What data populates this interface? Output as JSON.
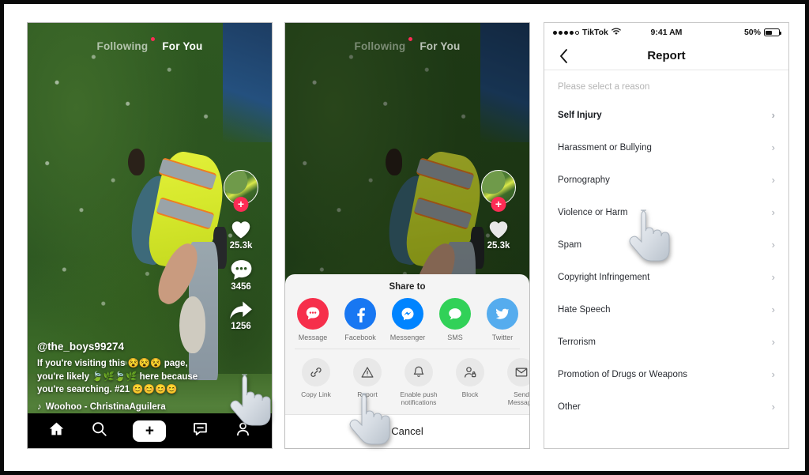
{
  "phone1": {
    "topnav": {
      "following": "Following",
      "for_you": "For You"
    },
    "rail": {
      "follow_badge": "+",
      "like_count": "25.3k",
      "comment_count": "3456",
      "share_count": "1256"
    },
    "caption": {
      "username": "@the_boys99274",
      "text": "If you're visiting this 😵😵😵 page, you're likely 🍃🌿🍃🌿 here because you're searching. #21 😊😊😊😊",
      "music": "Woohoo - ChristinaAguilera",
      "music_icon": "music-note-icon"
    },
    "bottomnav": [
      {
        "name": "home",
        "icon": "home-icon"
      },
      {
        "name": "discover",
        "icon": "search-icon"
      },
      {
        "name": "create",
        "icon": "plus-icon",
        "label": "+"
      },
      {
        "name": "inbox",
        "icon": "inbox-icon"
      },
      {
        "name": "profile",
        "icon": "person-icon"
      }
    ]
  },
  "phone2": {
    "topnav": {
      "following": "Following",
      "for_you": "For You"
    },
    "rail": {
      "follow_badge": "+",
      "like_count": "25.3k"
    },
    "sheet": {
      "title": "Share to",
      "share_targets": [
        {
          "label": "Message",
          "icon": "message-bubble-icon",
          "color": "#f62f4b"
        },
        {
          "label": "Facebook",
          "icon": "facebook-icon",
          "color": "#1877f2"
        },
        {
          "label": "Messenger",
          "icon": "messenger-icon",
          "color": "#0084ff"
        },
        {
          "label": "SMS",
          "icon": "sms-icon",
          "color": "#31d158"
        },
        {
          "label": "Twitter",
          "icon": "twitter-icon",
          "color": "#55acee"
        },
        {
          "label": "",
          "icon": "more-share-icon",
          "color": "#4a90e2"
        }
      ],
      "actions": [
        {
          "label": "Copy Link",
          "icon": "link-icon"
        },
        {
          "label": "Report",
          "icon": "warning-triangle-icon"
        },
        {
          "label": "Enable push notifications",
          "icon": "bell-icon"
        },
        {
          "label": "Block",
          "icon": "person-lock-icon"
        },
        {
          "label": "Send Message",
          "icon": "envelope-icon"
        }
      ],
      "cancel": "Cancel"
    }
  },
  "phone3": {
    "statusbar": {
      "carrier": "TikTok",
      "signal_icon": "signal-dots-icon",
      "wifi_icon": "wifi-icon",
      "time": "9:41 AM",
      "battery_percent": "50%",
      "battery_icon": "battery-icon"
    },
    "navbar": {
      "back_icon": "chevron-left-icon",
      "title": "Report"
    },
    "hint": "Please select a reason",
    "reasons": [
      {
        "label": "Self Injury",
        "chevron": "›"
      },
      {
        "label": "Harassment or Bullying",
        "chevron": "›"
      },
      {
        "label": "Pornography",
        "chevron": "›"
      },
      {
        "label": "Violence or Harm",
        "chevron": "›"
      },
      {
        "label": "Spam",
        "chevron": "›"
      },
      {
        "label": "Copyright Infringement",
        "chevron": "›"
      },
      {
        "label": "Hate Speech",
        "chevron": "›"
      },
      {
        "label": "Terrorism",
        "chevron": "›"
      },
      {
        "label": "Promotion of Drugs or Weapons",
        "chevron": "›"
      },
      {
        "label": "Other",
        "chevron": "›"
      }
    ]
  },
  "cursors": [
    {
      "name": "hand-cursor-phone1",
      "target": "share-button"
    },
    {
      "name": "hand-cursor-phone2",
      "target": "report-action"
    },
    {
      "name": "hand-cursor-phone3",
      "target": "violence-or-harm-row"
    }
  ],
  "colors": {
    "tiktok_red": "#fe2c55",
    "tiktok_cyan": "#25f4ee",
    "sheet_bg": "#f4f4f4",
    "text_dark": "#2a2d33"
  }
}
